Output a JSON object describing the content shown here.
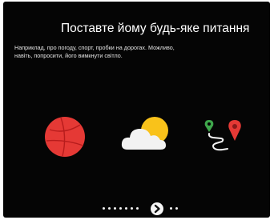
{
  "screen": {
    "title": "Поставте  йому будь-яке питання",
    "subtitle_line1": "Наприклад, про погоду, спорт, пробки на дорогах. Можливо,",
    "subtitle_line2": "навіть, попросити,  його вимкнути світло."
  },
  "icons": [
    "sports-ball-icon",
    "weather-cloud-sun-icon",
    "route-map-pin-icon"
  ],
  "pager": {
    "dots_before": 7,
    "dots_after": 2,
    "next_icon": "chevron-right-icon"
  },
  "colors": {
    "background": "#050505",
    "ball_red": "#e53935",
    "sun_yellow": "#f9c21a",
    "pin_red": "#e53935",
    "pin_green": "#3ea64b"
  }
}
